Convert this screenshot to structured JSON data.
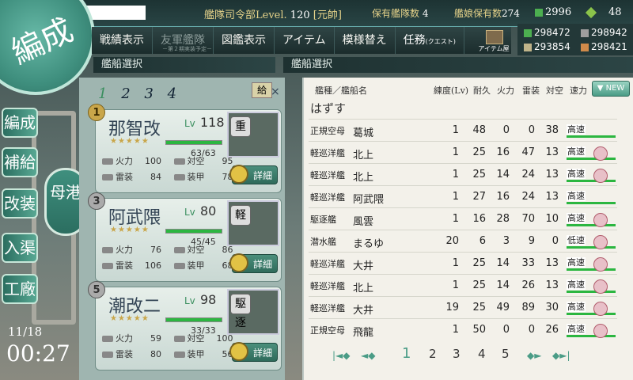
{
  "top_bar": {
    "hq_label": "艦隊司令部Level.",
    "hq_level": "120",
    "rank": "[元帥]",
    "fleet_count_label": "保有艦隊数",
    "fleet_count": "4",
    "shipgirl_count_label": "艦娘保有数",
    "shipgirl_count": "274",
    "buckets": "2996",
    "dev_materials": "48"
  },
  "menu": {
    "items": [
      {
        "label": "戦績表示"
      },
      {
        "label": "友軍艦隊",
        "sub": "－第２期実装予定－"
      },
      {
        "label": "図鑑表示"
      },
      {
        "label": "アイテム"
      },
      {
        "label": "模様替え"
      },
      {
        "label": "任務",
        "small": "(クエスト)"
      }
    ],
    "item_shop": "アイテム屋"
  },
  "resources": {
    "fuel": "298472",
    "ammo": "298942",
    "steel": "293854",
    "bauxite": "298421"
  },
  "titles": {
    "left": "艦船選択",
    "right": "艦船選択"
  },
  "logo": "編成",
  "side_nav": [
    "編成",
    "補給",
    "改装",
    "入渠",
    "工廠"
  ],
  "mother_port": "母港",
  "clock": {
    "date": "11/18",
    "time": "00:27"
  },
  "fleet": {
    "tabs": [
      "1",
      "2",
      "3",
      "4"
    ],
    "supply": "給",
    "ships": [
      {
        "num": "1",
        "name": "那智改",
        "lv_label": "Lv",
        "lv": "118",
        "hp": "63/63",
        "hp_frac": 1.0,
        "stars": "★★★★★",
        "type_badge": "重",
        "stats": [
          [
            "火力",
            "100"
          ],
          [
            "対空",
            "95"
          ],
          [
            "雷装",
            "84"
          ],
          [
            "装甲",
            "78"
          ]
        ],
        "detail": "詳細"
      },
      {
        "num": "3",
        "name": "阿武隈",
        "lv_label": "Lv",
        "lv": "80",
        "hp": "45/45",
        "hp_frac": 1.0,
        "stars": "★★★★★",
        "type_badge": "軽",
        "stats": [
          [
            "火力",
            "76"
          ],
          [
            "対空",
            "86"
          ],
          [
            "雷装",
            "106"
          ],
          [
            "装甲",
            "68"
          ]
        ],
        "detail": "詳細"
      },
      {
        "num": "5",
        "name": "潮改二",
        "lv_label": "Lv",
        "lv": "98",
        "hp": "33/33",
        "hp_frac": 1.0,
        "stars": "★★★★★",
        "type_badge": "駆逐",
        "stats": [
          [
            "火力",
            "59"
          ],
          [
            "対空",
            "100"
          ],
          [
            "雷装",
            "80"
          ],
          [
            "装甲",
            "56"
          ]
        ],
        "detail": "詳細"
      }
    ]
  },
  "list": {
    "headers": {
      "type_name": "艦種／艦船名",
      "level": "練度(Lv)",
      "hp": "耐久",
      "fire": "火力",
      "torp": "雷装",
      "aa": "対空",
      "speed": "速力"
    },
    "sort_button": "NEW",
    "unassign": "はずす",
    "rows": [
      {
        "type": "正規空母",
        "name": "葛城",
        "lv": "1",
        "hp": "48",
        "fire": "0",
        "torp": "0",
        "aa": "38",
        "speed": "高速",
        "lock": false
      },
      {
        "type": "軽巡洋艦",
        "name": "北上",
        "lv": "1",
        "hp": "25",
        "fire": "16",
        "torp": "47",
        "aa": "13",
        "speed": "高速",
        "lock": true
      },
      {
        "type": "軽巡洋艦",
        "name": "北上",
        "lv": "1",
        "hp": "25",
        "fire": "14",
        "torp": "24",
        "aa": "13",
        "speed": "高速",
        "lock": true
      },
      {
        "type": "軽巡洋艦",
        "name": "阿武隈",
        "lv": "1",
        "hp": "27",
        "fire": "16",
        "torp": "24",
        "aa": "13",
        "speed": "高速",
        "lock": false
      },
      {
        "type": "駆逐艦",
        "name": "風雲",
        "lv": "1",
        "hp": "16",
        "fire": "28",
        "torp": "70",
        "aa": "10",
        "speed": "高速",
        "lock": true
      },
      {
        "type": "潜水艦",
        "name": "まるゆ",
        "lv": "20",
        "hp": "6",
        "fire": "3",
        "torp": "9",
        "aa": "0",
        "speed": "低速",
        "lock": true
      },
      {
        "type": "軽巡洋艦",
        "name": "大井",
        "lv": "1",
        "hp": "25",
        "fire": "14",
        "torp": "33",
        "aa": "13",
        "speed": "高速",
        "lock": true
      },
      {
        "type": "軽巡洋艦",
        "name": "北上",
        "lv": "1",
        "hp": "25",
        "fire": "14",
        "torp": "26",
        "aa": "13",
        "speed": "高速",
        "lock": true
      },
      {
        "type": "軽巡洋艦",
        "name": "大井",
        "lv": "19",
        "hp": "25",
        "fire": "49",
        "torp": "89",
        "aa": "30",
        "speed": "高速",
        "lock": true
      },
      {
        "type": "正規空母",
        "name": "飛龍",
        "lv": "1",
        "hp": "50",
        "fire": "0",
        "torp": "0",
        "aa": "26",
        "speed": "高速",
        "lock": true
      }
    ]
  },
  "pager": {
    "pages": [
      "1",
      "2",
      "3",
      "4",
      "5"
    ],
    "current": "1"
  }
}
